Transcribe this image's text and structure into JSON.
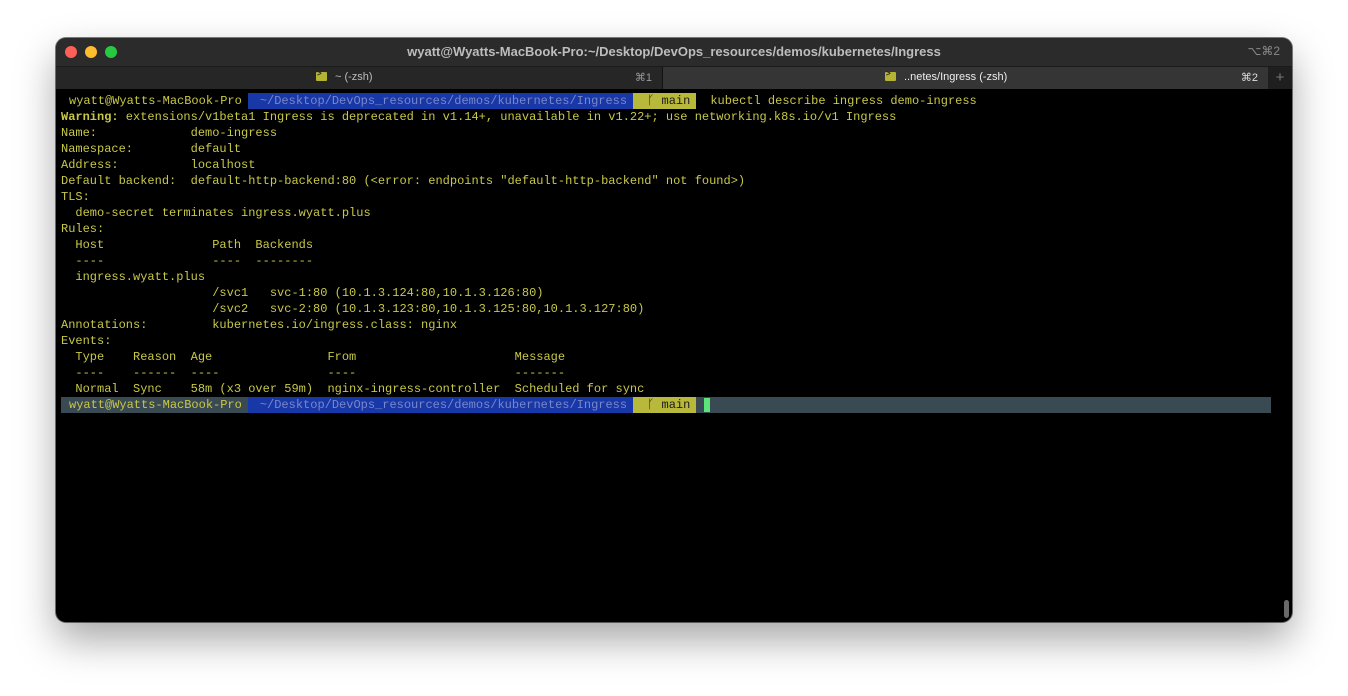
{
  "window": {
    "title": "wyatt@Wyatts-MacBook-Pro:~/Desktop/DevOps_resources/demos/kubernetes/Ingress",
    "title_shortcut": "⌥⌘2"
  },
  "tabs": [
    {
      "label": "~ (-zsh)",
      "shortcut": "⌘1"
    },
    {
      "label": "..netes/Ingress (-zsh)",
      "shortcut": "⌘2"
    }
  ],
  "prompt": {
    "user": "wyatt@Wyatts-MacBook-Pro",
    "path": "~/Desktop/DevOps_resources/demos/kubernetes/Ingress",
    "branch_icon": "git-branch-icon",
    "branch": "main",
    "command": "kubectl describe ingress demo-ingress"
  },
  "output": {
    "warning_label": "Warning:",
    "warning_text": " extensions/v1beta1 Ingress is deprecated in v1.14+, unavailable in v1.22+; use networking.k8s.io/v1 Ingress",
    "lines": [
      "Name:             demo-ingress",
      "Namespace:        default",
      "Address:          localhost",
      "Default backend:  default-http-backend:80 (<error: endpoints \"default-http-backend\" not found>)",
      "TLS:",
      "  demo-secret terminates ingress.wyatt.plus",
      "Rules:",
      "  Host               Path  Backends",
      "  ----               ----  --------",
      "  ingress.wyatt.plus",
      "                     /svc1   svc-1:80 (10.1.3.124:80,10.1.3.126:80)",
      "                     /svc2   svc-2:80 (10.1.3.123:80,10.1.3.125:80,10.1.3.127:80)",
      "Annotations:         kubernetes.io/ingress.class: nginx",
      "Events:",
      "  Type    Reason  Age                From                      Message",
      "  ----    ------  ----               ----                      -------",
      "  Normal  Sync    58m (x3 over 59m)  nginx-ingress-controller  Scheduled for sync"
    ]
  },
  "colors": {
    "terminal_text": "#c8c848",
    "path_segment": "#1838a8",
    "git_segment": "#b8b83a",
    "cursor": "#5ce67a"
  }
}
